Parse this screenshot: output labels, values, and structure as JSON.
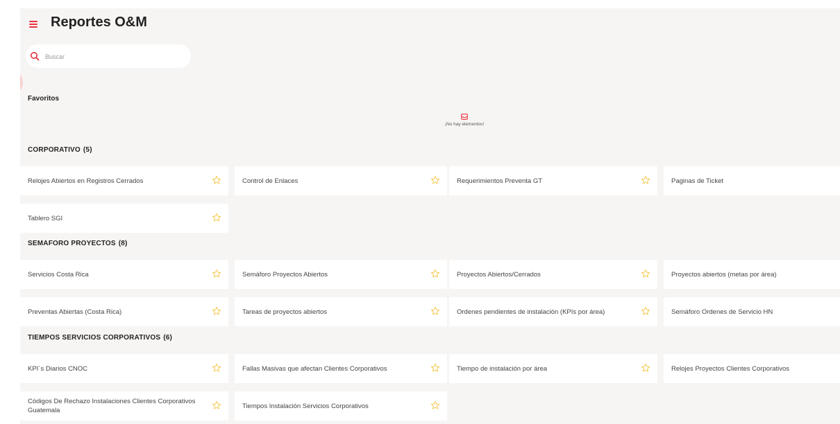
{
  "header": {
    "title": "Reportes O&M"
  },
  "search": {
    "placeholder": "Buscar"
  },
  "favorites": {
    "title": "Favoritos",
    "empty_text": "¡No hay elementos!"
  },
  "colors": {
    "accent": "#e8323e",
    "star": "#f4c542",
    "background": "#f7f5f4",
    "card": "#ffffff"
  },
  "groups": [
    {
      "title": "CORPORATIVO",
      "count": "(5)",
      "items": [
        {
          "label": "Relojes Abiertos en Registros Cerrados",
          "starred": false
        },
        {
          "label": "Control de Enlaces",
          "starred": false
        },
        {
          "label": "Requerimientos Preventa GT",
          "starred": false
        },
        {
          "label": "Paginas de Ticket",
          "starred": false
        },
        {
          "label": "Tablero SGI",
          "starred": false
        }
      ]
    },
    {
      "title": "SEMAFORO PROYECTOS",
      "count": "(8)",
      "items": [
        {
          "label": "Servicios Costa Rica",
          "starred": false
        },
        {
          "label": "Semáforo Proyectos Abiertos",
          "starred": false
        },
        {
          "label": "Proyectos Abiertos/Cerrados",
          "starred": false
        },
        {
          "label": "Proyectos abiertos (metas por área)",
          "starred": false
        },
        {
          "label": "Preventas Abiertas (Costa Rica)",
          "starred": false
        },
        {
          "label": "Tareas de proyectos abiertos",
          "starred": false
        },
        {
          "label": "Ordenes pendientes de instalación (KPIs por área)",
          "starred": false
        },
        {
          "label": "Semáforo Ordenes de Servicio HN",
          "starred": false
        }
      ]
    },
    {
      "title": "TIEMPOS SERVICIOS CORPORATIVOS",
      "count": "(6)",
      "items": [
        {
          "label": "KPI´s Diarios CNOC",
          "starred": false
        },
        {
          "label": "Fallas Masivas que afectan Clientes Corporativos",
          "starred": false
        },
        {
          "label": "Tiempo de instalación por área",
          "starred": false
        },
        {
          "label": "Relojes Proyectos Clientes Corporativos",
          "starred": false
        },
        {
          "label": "Códigos De Rechazo Instalaciones Clientes Corporativos Guatemala",
          "starred": false
        },
        {
          "label": "Tiempos Instalación Servicios Corporativos",
          "starred": false
        }
      ]
    }
  ]
}
